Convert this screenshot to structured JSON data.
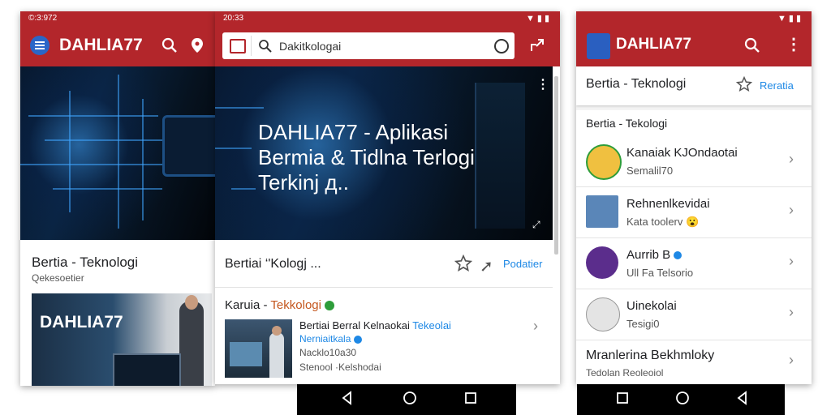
{
  "app_name": "DAHLIA77",
  "colors": {
    "brand": "#b3262b",
    "accent": "#1e88e5",
    "hero_bg": "#07182e"
  },
  "left_screen": {
    "status_time": "©:3:972",
    "hero_more": "⋮",
    "section_title": "Bertia - Teknologi",
    "section_sub": "Qekesoetier",
    "thumb_text": "DAHLIA77"
  },
  "middle_screen": {
    "status_time": "20:33",
    "search_value": "Dakitkologai",
    "hero_title_lines": [
      "DAHLIA77 - Aplikasi",
      "Bermia & Tidlna Terlogi",
      "Terkinj д.."
    ],
    "tab_title": "Bertiai ‘ʹKologj ...",
    "tab_action": "Podatier",
    "card_title_a": "Karuia - ",
    "card_title_b": "Tekkologi",
    "card_headline_a": "Bertiai Berral Kelnaokai ",
    "card_headline_b": "Tekeolai",
    "card_sub1": "Nerniaitkala",
    "card_sub2": "Nacklo10a30",
    "card_sub3": "Stenool  ·Kelshodai"
  },
  "right_screen": {
    "header_title": "Bertia - Teknologi",
    "header_action": "Reratia",
    "list_heading": "Bertia - Tekologi",
    "items": [
      {
        "title": "Kanaiak KJOndaotai",
        "sub": "Semalil70"
      },
      {
        "title": "Rehnenlkevidai",
        "sub": "Kata toolerv 😮"
      },
      {
        "title": "Aurrib B",
        "sub": "Ull Fa  Telsorio"
      },
      {
        "title": "Uinekolai",
        "sub": "Tesigi0"
      },
      {
        "title": "Mranlerina Bekhmloky",
        "sub": "Tedolan Reoleoiol"
      }
    ]
  },
  "icons": {
    "menu": "menu-icon",
    "search": "search-icon",
    "location": "location-icon",
    "more": "more-vert-icon",
    "star": "star-icon",
    "share": "share-icon",
    "back": "back-icon",
    "home": "home-icon",
    "recents": "recents-icon"
  }
}
